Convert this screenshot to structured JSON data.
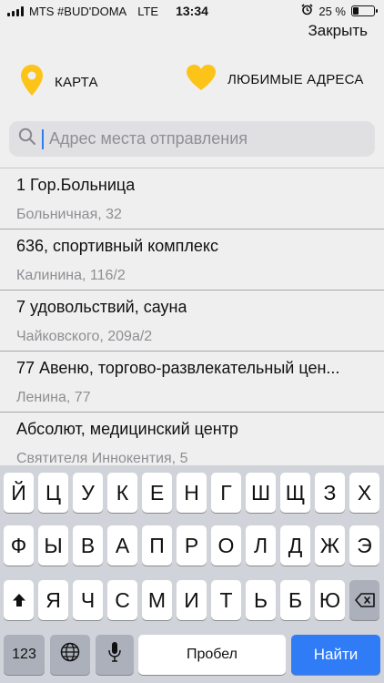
{
  "status_bar": {
    "carrier": "MTS #BUD'DOMA",
    "network": "LTE",
    "time": "13:34",
    "battery_text": "25 %",
    "battery_level": 0.25
  },
  "header": {
    "close_label": "Закрыть"
  },
  "quick_actions": {
    "map_label": "КАРТА",
    "favorites_label": "ЛЮБИМЫЕ АДРЕСА",
    "accent_color": "#fcc419"
  },
  "search": {
    "placeholder": "Адрес места отправления",
    "value": ""
  },
  "results": [
    {
      "title": "1 Гор.Больница",
      "address": "Больничная, 32"
    },
    {
      "title": "636, спортивный комплекс",
      "address": "Калинина, 116/2"
    },
    {
      "title": "7 удовольствий, сауна",
      "address": "Чайковского, 209а/2"
    },
    {
      "title": "77 Авеню, торгово-развлекательный цен...",
      "address": "Ленина, 77"
    },
    {
      "title": "Абсолют, медицинский центр",
      "address": "Святителя Иннокентия, 5"
    }
  ],
  "keyboard": {
    "row1": [
      "Й",
      "Ц",
      "У",
      "К",
      "Е",
      "Н",
      "Г",
      "Ш",
      "Щ",
      "З",
      "Х"
    ],
    "row2": [
      "Ф",
      "Ы",
      "В",
      "А",
      "П",
      "Р",
      "О",
      "Л",
      "Д",
      "Ж",
      "Э"
    ],
    "row3": [
      "Я",
      "Ч",
      "С",
      "М",
      "И",
      "Т",
      "Ь",
      "Б",
      "Ю"
    ],
    "numbers_label": "123",
    "space_label": "Пробел",
    "go_label": "Найти",
    "go_color": "#2f7cf6"
  }
}
